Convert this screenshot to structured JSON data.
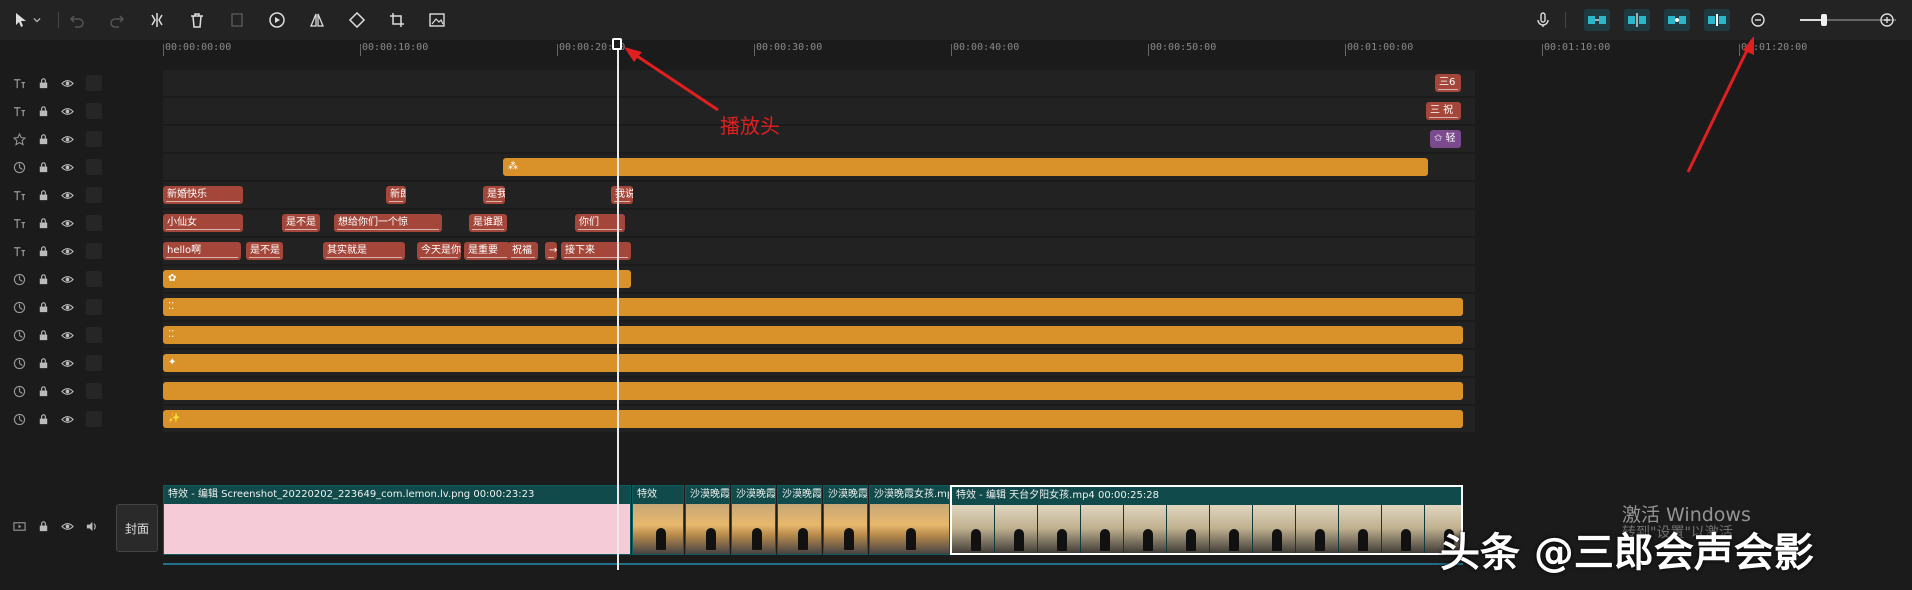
{
  "ruler": {
    "ticks": [
      "00:00:00:00",
      "00:00:10:00",
      "00:00:20:00",
      "00:00:30:00",
      "00:00:40:00",
      "00:00:50:00",
      "00:01:00:00",
      "00:01:10:00",
      "00:01:20:00"
    ]
  },
  "toolbar": {
    "zoom_level": 0.25,
    "icons": [
      "pointer-icon",
      "chevron-down-icon",
      "undo-icon",
      "redo-icon",
      "split-icon",
      "delete-icon",
      "freeze-frame-icon",
      "play-icon",
      "mirror-icon",
      "rotate-icon",
      "crop-icon",
      "image-adjust-icon"
    ],
    "right_icons": [
      "microphone-icon",
      "snap-main-icon",
      "snap-link-icon",
      "snap-preview-icon",
      "snap-split-icon",
      "zoom-out-icon",
      "zoom-in-icon"
    ]
  },
  "tracks": [
    {
      "type": "text",
      "clips": [
        {
          "label": "三6",
          "color": "#a4473a"
        }
      ]
    },
    {
      "type": "text",
      "clips": [
        {
          "label": "三  祝",
          "color": "#a4473a"
        }
      ]
    },
    {
      "type": "sticker",
      "clips": [
        {
          "label": "✩ 轻",
          "color": "#7c4a8e"
        }
      ]
    },
    {
      "type": "effect",
      "clips": [
        {
          "label": "⁂",
          "color": "#d9922a"
        }
      ]
    },
    {
      "type": "text",
      "clips": [
        {
          "label": "新婚快乐"
        },
        {
          "label": "新郎"
        },
        {
          "label": "是我"
        },
        {
          "label": "我说"
        }
      ]
    },
    {
      "type": "text",
      "clips": [
        {
          "label": "小仙女"
        },
        {
          "label": "是不是"
        },
        {
          "label": "想给你们一个惊"
        },
        {
          "label": "是谁跟"
        },
        {
          "label": "你们"
        }
      ]
    },
    {
      "type": "text",
      "clips": [
        {
          "label": "hello啊"
        },
        {
          "label": "是不是"
        },
        {
          "label": "其实就是"
        },
        {
          "label": "今天是你"
        },
        {
          "label": "是重要"
        },
        {
          "label": "祝福"
        },
        {
          "label": "→"
        },
        {
          "label": "接下来"
        }
      ]
    },
    {
      "type": "effect",
      "clips": [
        {
          "label": "✿"
        }
      ]
    },
    {
      "type": "effect",
      "clips": [
        {
          "label": "⁚⁚"
        }
      ]
    },
    {
      "type": "effect",
      "clips": [
        {
          "label": "⁚⁚"
        }
      ]
    },
    {
      "type": "effect",
      "clips": [
        {
          "label": "✦"
        }
      ]
    },
    {
      "type": "effect",
      "clips": [
        {
          "label": ""
        }
      ]
    },
    {
      "type": "effect",
      "clips": [
        {
          "label": "✨"
        }
      ]
    }
  ],
  "main_track": {
    "cover_label": "封面",
    "clip1": {
      "label": "特效 - 编辑  Screenshot_20220202_223649_com.lemon.lv.png   00:00:23:23"
    },
    "small_clips": [
      {
        "label": "特效"
      },
      {
        "label": "沙漠晚霞"
      },
      {
        "label": "沙漠晚霞"
      },
      {
        "label": "沙漠晚霞"
      },
      {
        "label": "沙漠晚霞"
      },
      {
        "label": "沙漠晚霞女孩.mp4"
      }
    ],
    "clip_last": {
      "label": "特效 - 编辑   天台夕阳女孩.mp4   00:00:25:28"
    }
  },
  "annotations": {
    "playhead_label": "播放头",
    "watermark": "头条 @三郎会声会影",
    "activate_windows": "激活 Windows",
    "activate_sub": "转到\"设置\"以激活"
  },
  "colors": {
    "text_clip": "#a4473a",
    "effect_clip": "#d9922a",
    "sticker_clip": "#7c4a8e",
    "video_clip": "#104a4a",
    "annotation_red": "#e02020"
  }
}
